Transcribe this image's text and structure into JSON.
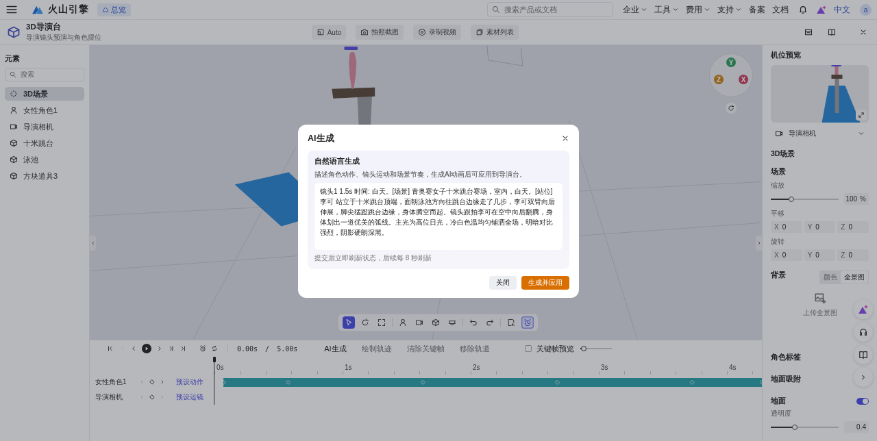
{
  "topbar": {
    "brand": "火山引擎",
    "home_tab": "总览",
    "search": {
      "placeholder": "搜索产品或文档"
    },
    "menus": [
      {
        "label": "企业",
        "dropdown": true
      },
      {
        "label": "工具",
        "dropdown": true
      },
      {
        "label": "费用",
        "dropdown": true
      },
      {
        "label": "支持",
        "dropdown": true
      },
      {
        "label": "备案",
        "dropdown": false
      },
      {
        "label": "文档",
        "dropdown": false
      }
    ],
    "language": "中文",
    "avatar": "a"
  },
  "header": {
    "title": "3D导演台",
    "subtitle": "导演镜头预演与角色摆位",
    "actions": [
      {
        "label": "Auto",
        "kind": "auto"
      },
      {
        "label": "拍照截图",
        "kind": "camera"
      },
      {
        "label": "录制视频",
        "kind": "record"
      },
      {
        "label": "素材列表",
        "kind": "gallery"
      }
    ]
  },
  "sidebar": {
    "title": "元素",
    "search": {
      "placeholder": "搜索"
    },
    "items": [
      {
        "label": "3D场景",
        "kind": "scene",
        "selected": true
      },
      {
        "label": "女性角色1",
        "kind": "person",
        "selected": false
      },
      {
        "label": "导演相机",
        "kind": "videocam",
        "selected": false
      },
      {
        "label": "十米跳台",
        "kind": "object",
        "selected": false
      },
      {
        "label": "泳池",
        "kind": "object",
        "selected": false
      },
      {
        "label": "方块道具3",
        "kind": "object",
        "selected": false
      }
    ]
  },
  "viewport": {
    "gizmo": [
      {
        "axis": "Y"
      },
      {
        "axis": "Z"
      },
      {
        "axis": "X"
      }
    ],
    "toolbar": [
      {
        "kind": "select",
        "selected": true,
        "on": false
      },
      {
        "kind": "rotate",
        "selected": false,
        "on": false
      },
      {
        "kind": "scale",
        "selected": false,
        "on": false
      },
      {
        "kind": "person",
        "selected": false,
        "on": false
      },
      {
        "kind": "videocam",
        "selected": false,
        "on": false
      },
      {
        "kind": "object",
        "selected": false,
        "on": false
      },
      {
        "kind": "stage",
        "selected": false,
        "on": false
      },
      {
        "kind": "undo",
        "selected": false,
        "on": false
      },
      {
        "kind": "redo",
        "selected": false,
        "on": false
      },
      {
        "kind": "keyframe",
        "selected": false,
        "on": false
      },
      {
        "kind": "alarm",
        "selected": false,
        "on": true
      }
    ]
  },
  "timeline": {
    "controls": [
      {
        "kind": "first",
        "disabled": false
      },
      {
        "kind": "prevkey",
        "disabled": true
      },
      {
        "kind": "prev",
        "disabled": false
      },
      {
        "kind": "play",
        "disabled": false
      },
      {
        "kind": "next",
        "disabled": false
      },
      {
        "kind": "nextkey",
        "disabled": false
      },
      {
        "kind": "last",
        "disabled": false
      },
      {
        "kind": "alarm",
        "disabled": false
      },
      {
        "kind": "loop",
        "disabled": false
      }
    ],
    "current_time": "0.00s",
    "separator": "/",
    "duration": "5.00s",
    "actions": [
      {
        "label": "AI生成",
        "disabled": false
      },
      {
        "label": "绘制轨迹",
        "disabled": true
      },
      {
        "label": "清除关键帧",
        "disabled": true
      },
      {
        "label": "移除轨道",
        "disabled": true
      }
    ],
    "keyframe_preview": {
      "label": "关键帧预览",
      "checked": false
    },
    "zoom": {
      "level": 0.12
    },
    "ruler": [
      "0s",
      "1s",
      "2s",
      "3s",
      "4s"
    ],
    "tracks": [
      {
        "name": "女性角色1",
        "action": "预设动作",
        "prev_disabled": true,
        "next_disabled": false,
        "has_clip": true
      },
      {
        "name": "导演相机",
        "action": "预设运镜",
        "prev_disabled": true,
        "next_disabled": true,
        "has_clip": false
      }
    ]
  },
  "right_panel": {
    "preview_title": "机位预览",
    "camera": "导演相机",
    "scene_title": "3D场景",
    "section": "场景",
    "scale": {
      "label": "缩放",
      "level": 0.3,
      "value": "100",
      "unit": "%"
    },
    "translate": {
      "label": "平移",
      "axes": [
        {
          "axis": "X",
          "value": "0"
        },
        {
          "axis": "Y",
          "value": "0"
        },
        {
          "axis": "Z",
          "value": "0"
        }
      ]
    },
    "rotate": {
      "label": "旋转",
      "axes": [
        {
          "axis": "X",
          "value": "0"
        },
        {
          "axis": "Y",
          "value": "0"
        },
        {
          "axis": "Z",
          "value": "0"
        }
      ]
    },
    "background": {
      "label": "背景",
      "tabs": [
        {
          "label": "颜色",
          "selected": false
        },
        {
          "label": "全景图",
          "selected": true
        }
      ],
      "upload": "上传全景图"
    },
    "role_labels": "角色标签",
    "ground_snap": "地面吸附",
    "ground": {
      "label": "地面",
      "on": true
    },
    "opacity": {
      "label": "透明度",
      "level": 0.35,
      "value": "0.4"
    }
  },
  "floating_buttons": [
    {
      "kind": "ai"
    },
    {
      "kind": "headset"
    },
    {
      "kind": "book"
    },
    {
      "kind": "chevron"
    }
  ],
  "modal": {
    "title": "AI生成",
    "section_title": "自然语言生成",
    "description": "描述角色动作、镜头运动和场景节奏，生成AI动画后可应用到导演台。",
    "prompt": "镜头1 1.5s 时间: 白天。[场景] 青奥赛女子十米跳台赛场，室内，白天。[站位] 李可 站立于十米跳台顶端，面朝泳池方向往跳台边缘走了几步，李可双臂向后伸展，脚尖猛蹬跳台边缘，身体腾空而起。镜头跟拍李可在空中向后翻腾，身体划出一道优美的弧线。主光为高位日光，冷白色温均匀铺洒全场，明暗对比强烈，阴影硬朗深黑。",
    "hint": "提交后立即刷新状态，后续每 8 秒刷新",
    "buttons": [
      {
        "label": "关闭",
        "kind": "secondary"
      },
      {
        "label": "生成并应用",
        "kind": "primary"
      }
    ]
  }
}
